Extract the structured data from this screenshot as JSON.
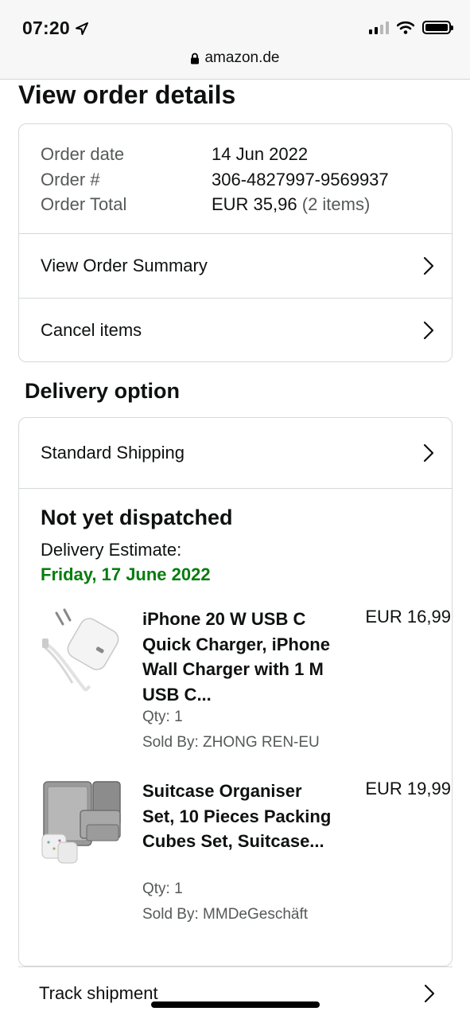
{
  "status_bar": {
    "time": "07:20"
  },
  "browser": {
    "url": "amazon.de"
  },
  "page": {
    "title": "View order details"
  },
  "order": {
    "date_label": "Order date",
    "date_value": "14 Jun 2022",
    "number_label": "Order #",
    "number_value": "306-4827997-9569937",
    "total_label": "Order Total",
    "total_value": "EUR 35,96",
    "total_items": "(2 items)"
  },
  "links": {
    "view_summary": "View Order Summary",
    "cancel_items": "Cancel items"
  },
  "delivery": {
    "section_title": "Delivery option",
    "shipping": "Standard Shipping",
    "status": "Not yet dispatched",
    "estimate_label": "Delivery Estimate:",
    "estimate_date": "Friday, 17 June 2022",
    "date_color": "#067d0e"
  },
  "items": [
    {
      "name": "iPhone 20 W USB C Quick Charger, iPhone Wall Charger with 1 M USB C...",
      "price": "EUR 16,99",
      "qty": "Qty: 1",
      "seller": "Sold By: ZHONG REN-EU",
      "image": "usb-charger-image"
    },
    {
      "name": "Suitcase Organiser Set, 10 Pieces Packing Cubes Set, Suitcase...",
      "price": "EUR 19,99",
      "qty": "Qty: 1",
      "seller": "Sold By: MMDeGeschäft",
      "image": "packing-cubes-image"
    }
  ],
  "track": {
    "label": "Track shipment"
  },
  "icons": {
    "location": "location-arrow-icon",
    "lock": "lock-icon",
    "chevron": "chevron-right-icon",
    "signal": "signal-icon",
    "wifi": "wifi-icon",
    "battery": "battery-icon"
  }
}
